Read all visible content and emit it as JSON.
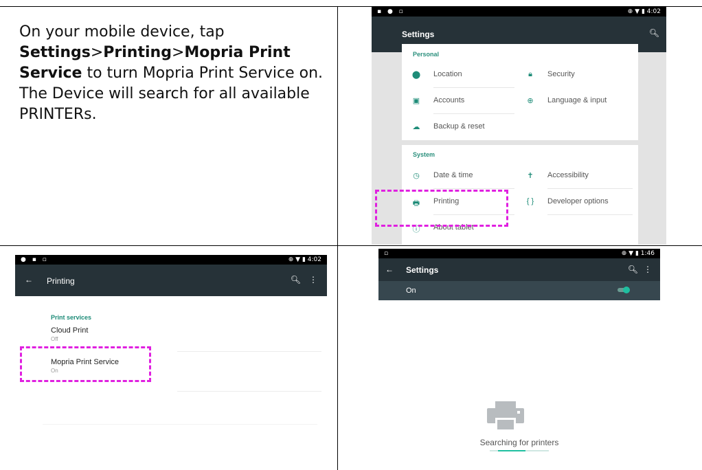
{
  "instruction": {
    "prefix": "On your mobile device, tap ",
    "settings": "Settings",
    "sep1": ">",
    "printing": "Printing",
    "sep2": ">",
    "mopria": "Mopria Print Service",
    "suffix": " to turn Mopria Print Service on. The Device will search for all available PRINTERs."
  },
  "screen_settings": {
    "status_time": "4:02",
    "title": "Settings",
    "personal_header": "Personal",
    "personal_items": [
      {
        "label": "Location",
        "icon": "location-pin-icon"
      },
      {
        "label": "Security",
        "icon": "lock-icon"
      },
      {
        "label": "Accounts",
        "icon": "account-icon"
      },
      {
        "label": "Language & input",
        "icon": "globe-icon"
      },
      {
        "label": "Backup & reset",
        "icon": "cloud-upload-icon"
      }
    ],
    "system_header": "System",
    "system_items": [
      {
        "label": "Date & time",
        "icon": "clock-icon"
      },
      {
        "label": "Accessibility",
        "icon": "accessibility-icon"
      },
      {
        "label": "Printing",
        "icon": "printer-icon"
      },
      {
        "label": "Developer options",
        "icon": "braces-icon"
      },
      {
        "label": "About tablet",
        "icon": "info-icon"
      }
    ]
  },
  "screen_printing": {
    "status_time": "4:02",
    "title": "Printing",
    "section_header": "Print services",
    "services": [
      {
        "name": "Cloud Print",
        "status": "Off"
      },
      {
        "name": "Mopria Print Service",
        "status": "On"
      }
    ]
  },
  "screen_search": {
    "status_time": "1:46",
    "title": "Settings",
    "toggle_label": "On",
    "searching_text": "Searching for printers"
  },
  "colors": {
    "appbar": "#263238",
    "accent": "#1e8c78",
    "highlight": "#e020e0"
  }
}
